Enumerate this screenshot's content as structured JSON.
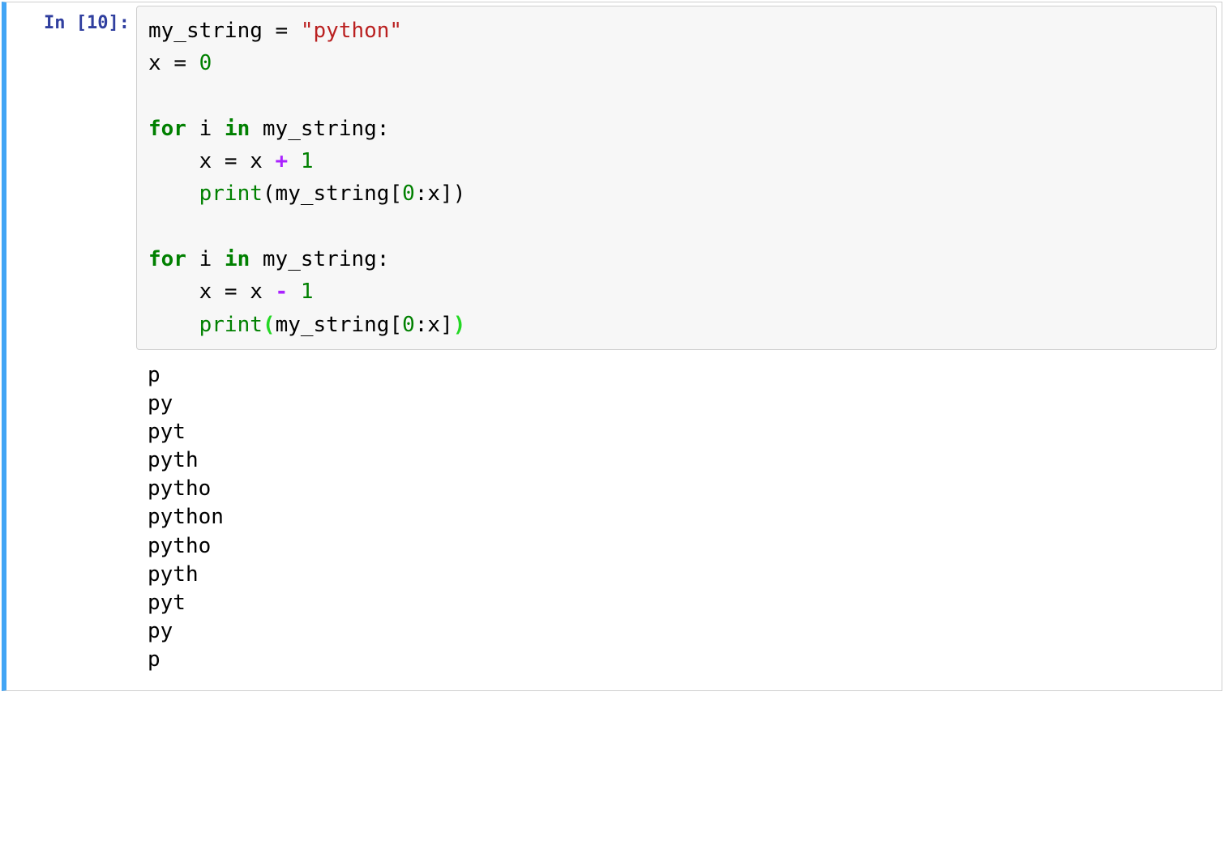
{
  "cell": {
    "prompt": {
      "label": "In",
      "number": "10"
    },
    "code_tokens": [
      [
        {
          "t": "my_string ",
          "c": "cm-var"
        },
        {
          "t": "=",
          "c": "cm-eq"
        },
        {
          "t": " ",
          "c": "cm-var"
        },
        {
          "t": "\"python\"",
          "c": "cm-str"
        }
      ],
      [
        {
          "t": "x ",
          "c": "cm-var"
        },
        {
          "t": "=",
          "c": "cm-eq"
        },
        {
          "t": " ",
          "c": "cm-var"
        },
        {
          "t": "0",
          "c": "cm-num"
        }
      ],
      [],
      [
        {
          "t": "for",
          "c": "cm-kw"
        },
        {
          "t": " i ",
          "c": "cm-var"
        },
        {
          "t": "in",
          "c": "cm-kw"
        },
        {
          "t": " my_string:",
          "c": "cm-var"
        }
      ],
      [
        {
          "t": "    x ",
          "c": "cm-var"
        },
        {
          "t": "=",
          "c": "cm-eq"
        },
        {
          "t": " x ",
          "c": "cm-var"
        },
        {
          "t": "+",
          "c": "cm-op"
        },
        {
          "t": " ",
          "c": "cm-var"
        },
        {
          "t": "1",
          "c": "cm-num"
        }
      ],
      [
        {
          "t": "    ",
          "c": "cm-var"
        },
        {
          "t": "print",
          "c": "cm-builtin"
        },
        {
          "t": "(my_string[",
          "c": "cm-punct"
        },
        {
          "t": "0",
          "c": "cm-num"
        },
        {
          "t": ":x])",
          "c": "cm-punct"
        }
      ],
      [
        {
          "t": "    ",
          "c": "cm-var"
        }
      ],
      [
        {
          "t": "for",
          "c": "cm-kw"
        },
        {
          "t": " i ",
          "c": "cm-var"
        },
        {
          "t": "in",
          "c": "cm-kw"
        },
        {
          "t": " my_string:",
          "c": "cm-var"
        }
      ],
      [
        {
          "t": "    x ",
          "c": "cm-var"
        },
        {
          "t": "=",
          "c": "cm-eq"
        },
        {
          "t": " x ",
          "c": "cm-var"
        },
        {
          "t": "-",
          "c": "cm-op"
        },
        {
          "t": " ",
          "c": "cm-var"
        },
        {
          "t": "1",
          "c": "cm-num"
        }
      ],
      [
        {
          "t": "    ",
          "c": "cm-var"
        },
        {
          "t": "print",
          "c": "cm-builtin"
        },
        {
          "t": "(",
          "c": "cm-brk-m"
        },
        {
          "t": "my_string[",
          "c": "cm-punct"
        },
        {
          "t": "0",
          "c": "cm-num"
        },
        {
          "t": ":x]",
          "c": "cm-punct"
        },
        {
          "t": ")",
          "c": "cm-brk-m"
        }
      ]
    ],
    "output_lines": [
      "p",
      "py",
      "pyt",
      "pyth",
      "pytho",
      "python",
      "pytho",
      "pyth",
      "pyt",
      "py",
      "p",
      ""
    ]
  }
}
